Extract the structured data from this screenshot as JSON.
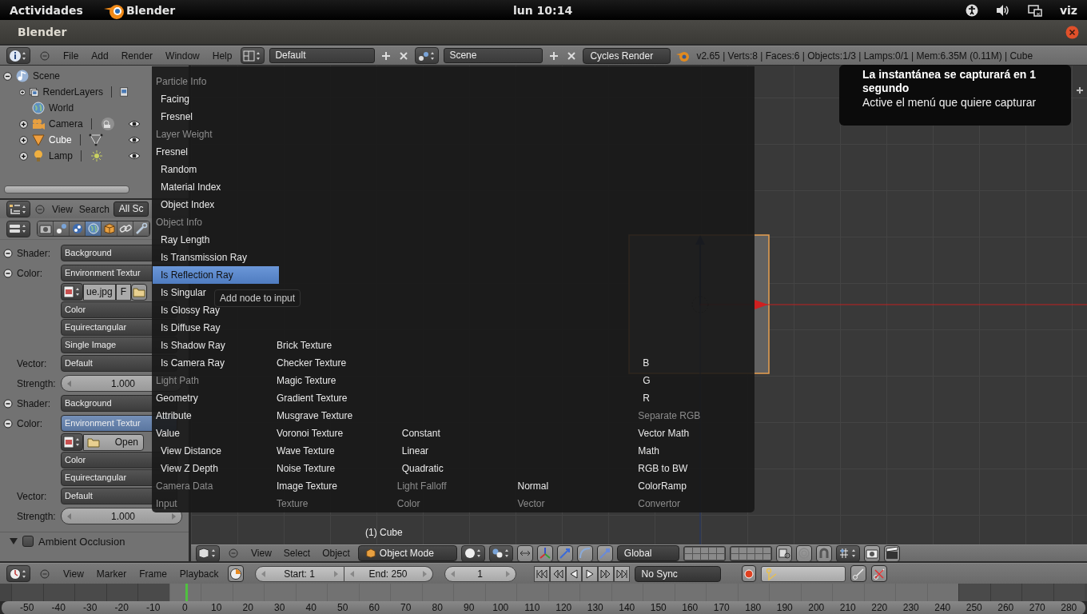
{
  "top_bar": {
    "activities": "Actividades",
    "app": "Blender",
    "clock": "lun 10:14",
    "user": "viz"
  },
  "window": {
    "title": "Blender"
  },
  "info_header": {
    "menus": [
      "File",
      "Add",
      "Render",
      "Window",
      "Help"
    ],
    "layout": "Default",
    "scene": "Scene",
    "engine": "Cycles Render",
    "stats": "v2.65 | Verts:8 | Faces:6 | Objects:1/3 | Lamps:0/1 | Mem:6.35M (0.11M) | Cube"
  },
  "outliner": {
    "items": [
      {
        "label": "Scene",
        "kind": "scene",
        "expanded": true,
        "selected": false,
        "children": [
          {
            "label": "RenderLayers",
            "kind": "renderlayers",
            "expanded": false,
            "selected": false
          },
          {
            "label": "World",
            "kind": "world",
            "selected": false
          },
          {
            "label": "Camera",
            "kind": "camera",
            "expanded": false,
            "selected": false
          },
          {
            "label": "Cube",
            "kind": "mesh",
            "expanded": false,
            "selected": true
          },
          {
            "label": "Lamp",
            "kind": "lamp",
            "expanded": false,
            "selected": false
          }
        ]
      }
    ]
  },
  "properties": {
    "menus": [
      "View",
      "Search"
    ],
    "scope": "All Sc",
    "tabs": [
      {
        "kind": "render",
        "selected": false
      },
      {
        "kind": "layers",
        "selected": false
      },
      {
        "kind": "scene",
        "selected": false
      },
      {
        "kind": "world",
        "selected": true
      },
      {
        "kind": "object",
        "selected": false
      },
      {
        "kind": "constraints",
        "selected": false
      },
      {
        "kind": "modifiers",
        "selected": false
      }
    ],
    "rows": [
      {
        "kind": "dropdown",
        "label": "Shader:",
        "socket": true,
        "value": "Background",
        "active": false
      },
      {
        "kind": "dropdown",
        "label": "Color:",
        "socket": true,
        "value": "Environment Textur",
        "active": false
      },
      {
        "kind": "image",
        "file": "ue.jpg",
        "flag": "F"
      },
      {
        "kind": "dropdown",
        "socket": false,
        "value": "Color",
        "active": false
      },
      {
        "kind": "dropdown",
        "socket": false,
        "value": "Equirectangular",
        "active": false
      },
      {
        "kind": "dropdown",
        "socket": false,
        "value": "Single Image",
        "active": false
      },
      {
        "kind": "dropdown",
        "label": "Vector:",
        "socket": false,
        "value": "Default",
        "active": false
      },
      {
        "kind": "slider",
        "label": "Strength:",
        "value": "1.000"
      },
      {
        "kind": "dropdown",
        "label": "Shader:",
        "socket": true,
        "value": "Background",
        "active": false
      },
      {
        "kind": "dropdown",
        "label": "Color:",
        "socket": true,
        "value": "Environment Textur",
        "active": true
      },
      {
        "kind": "open",
        "button": "Open"
      },
      {
        "kind": "dropdown",
        "socket": false,
        "value": "Color",
        "active": false
      },
      {
        "kind": "dropdown",
        "socket": false,
        "value": "Equirectangular",
        "active": false
      },
      {
        "kind": "dropdown",
        "label": "Vector:",
        "socket": false,
        "value": "Default",
        "active": false
      },
      {
        "kind": "slider",
        "label": "Strength:",
        "value": "1.000"
      }
    ],
    "panel": {
      "title": "Ambient Occlusion",
      "checked": false,
      "expanded": true
    }
  },
  "node_menu": {
    "tooltip": "Add node to input",
    "columns": [
      {
        "title": "Input",
        "entries": [
          {
            "kind": "heading",
            "label": "Particle Info",
            "selected": false
          },
          {
            "kind": "subitem",
            "label": "Facing",
            "selected": false
          },
          {
            "kind": "subitem",
            "label": "Fresnel",
            "selected": false
          },
          {
            "kind": "heading",
            "label": "Layer Weight",
            "selected": false
          },
          {
            "kind": "item",
            "label": "Fresnel",
            "selected": false
          },
          {
            "kind": "subitem",
            "label": "Random",
            "selected": false
          },
          {
            "kind": "subitem",
            "label": "Material Index",
            "selected": false
          },
          {
            "kind": "subitem",
            "label": "Object Index",
            "selected": false
          },
          {
            "kind": "heading",
            "label": "Object Info",
            "selected": false
          },
          {
            "kind": "subitem",
            "label": "Ray Length",
            "selected": false
          },
          {
            "kind": "subitem",
            "label": "Is Transmission Ray",
            "selected": false
          },
          {
            "kind": "subitem",
            "label": "Is Reflection Ray",
            "selected": true
          },
          {
            "kind": "subitem",
            "label": "Is Singular",
            "selected": false
          },
          {
            "kind": "subitem",
            "label": "Is Glossy Ray",
            "selected": false
          },
          {
            "kind": "subitem",
            "label": "Is Diffuse Ray",
            "selected": false
          },
          {
            "kind": "subitem",
            "label": "Is Shadow Ray",
            "selected": false
          },
          {
            "kind": "subitem",
            "label": "Is Camera Ray",
            "selected": false
          },
          {
            "kind": "heading",
            "label": "Light Path",
            "selected": false
          },
          {
            "kind": "item",
            "label": "Geometry",
            "selected": false
          },
          {
            "kind": "item",
            "label": "Attribute",
            "selected": false
          },
          {
            "kind": "item",
            "label": "Value",
            "selected": false
          },
          {
            "kind": "subitem",
            "label": "View Distance",
            "selected": false
          },
          {
            "kind": "subitem",
            "label": "View Z Depth",
            "selected": false
          },
          {
            "kind": "heading",
            "label": "Camera Data",
            "selected": false
          }
        ]
      },
      {
        "title": "Texture",
        "entries": [
          {
            "kind": "item",
            "label": "Brick Texture",
            "selected": false
          },
          {
            "kind": "item",
            "label": "Checker Texture",
            "selected": false
          },
          {
            "kind": "item",
            "label": "Magic Texture",
            "selected": false
          },
          {
            "kind": "item",
            "label": "Gradient Texture",
            "selected": false
          },
          {
            "kind": "item",
            "label": "Musgrave Texture",
            "selected": false
          },
          {
            "kind": "item",
            "label": "Voronoi Texture",
            "selected": false
          },
          {
            "kind": "item",
            "label": "Wave Texture",
            "selected": false
          },
          {
            "kind": "item",
            "label": "Noise Texture",
            "selected": false
          },
          {
            "kind": "item",
            "label": "Image Texture",
            "selected": false
          }
        ]
      },
      {
        "title": "Color",
        "entries": [
          {
            "kind": "subitem",
            "label": "Constant",
            "selected": false
          },
          {
            "kind": "subitem",
            "label": "Linear",
            "selected": false
          },
          {
            "kind": "subitem",
            "label": "Quadratic",
            "selected": false
          },
          {
            "kind": "heading",
            "label": "Light Falloff",
            "selected": false
          }
        ]
      },
      {
        "title": "Vector",
        "entries": [
          {
            "kind": "item",
            "label": "Normal",
            "selected": false
          }
        ]
      },
      {
        "title": "Convertor",
        "entries": [
          {
            "kind": "subitem",
            "label": "B",
            "selected": false
          },
          {
            "kind": "subitem",
            "label": "G",
            "selected": false
          },
          {
            "kind": "subitem",
            "label": "R",
            "selected": false
          },
          {
            "kind": "heading",
            "label": "Separate RGB",
            "selected": false
          },
          {
            "kind": "item",
            "label": "Vector Math",
            "selected": false
          },
          {
            "kind": "item",
            "label": "Math",
            "selected": false
          },
          {
            "kind": "item",
            "label": "RGB to BW",
            "selected": false
          },
          {
            "kind": "item",
            "label": "ColorRamp",
            "selected": false
          }
        ]
      }
    ]
  },
  "viewport": {
    "object_label": "(1) Cube"
  },
  "viewport_header": {
    "menus": [
      "View",
      "Select",
      "Object"
    ],
    "mode": "Object Mode",
    "orientation": "Global"
  },
  "timeline": {
    "menus": [
      "View",
      "Marker",
      "Frame",
      "Playback"
    ],
    "start": "Start: 1",
    "end": "End: 250",
    "frame": "1",
    "sync": "No Sync",
    "ticks": [
      {
        "label": "-50",
        "in_range": false,
        "current": false
      },
      {
        "label": "-40",
        "in_range": false,
        "current": false
      },
      {
        "label": "-30",
        "in_range": false,
        "current": false
      },
      {
        "label": "-20",
        "in_range": false,
        "current": false
      },
      {
        "label": "-10",
        "in_range": false,
        "current": false
      },
      {
        "label": "0",
        "in_range": true,
        "current": true
      },
      {
        "label": "10",
        "in_range": true,
        "current": false
      },
      {
        "label": "20",
        "in_range": true,
        "current": false
      },
      {
        "label": "30",
        "in_range": true,
        "current": false
      },
      {
        "label": "40",
        "in_range": true,
        "current": false
      },
      {
        "label": "50",
        "in_range": true,
        "current": false
      },
      {
        "label": "60",
        "in_range": true,
        "current": false
      },
      {
        "label": "70",
        "in_range": true,
        "current": false
      },
      {
        "label": "80",
        "in_range": true,
        "current": false
      },
      {
        "label": "90",
        "in_range": true,
        "current": false
      },
      {
        "label": "100",
        "in_range": true,
        "current": false
      },
      {
        "label": "110",
        "in_range": true,
        "current": false
      },
      {
        "label": "120",
        "in_range": true,
        "current": false
      },
      {
        "label": "130",
        "in_range": true,
        "current": false
      },
      {
        "label": "140",
        "in_range": true,
        "current": false
      },
      {
        "label": "150",
        "in_range": true,
        "current": false
      },
      {
        "label": "160",
        "in_range": true,
        "current": false
      },
      {
        "label": "170",
        "in_range": true,
        "current": false
      },
      {
        "label": "180",
        "in_range": true,
        "current": false
      },
      {
        "label": "190",
        "in_range": true,
        "current": false
      },
      {
        "label": "200",
        "in_range": true,
        "current": false
      },
      {
        "label": "210",
        "in_range": true,
        "current": false
      },
      {
        "label": "220",
        "in_range": true,
        "current": false
      },
      {
        "label": "230",
        "in_range": true,
        "current": false
      },
      {
        "label": "240",
        "in_range": true,
        "current": false
      },
      {
        "label": "250",
        "in_range": false,
        "current": false
      },
      {
        "label": "260",
        "in_range": false,
        "current": false
      },
      {
        "label": "270",
        "in_range": false,
        "current": false
      },
      {
        "label": "280",
        "in_range": false,
        "current": false
      }
    ]
  },
  "notification": {
    "title": "La instantánea se capturará en 1 segundo",
    "body": "Active el menú que quiere capturar"
  }
}
